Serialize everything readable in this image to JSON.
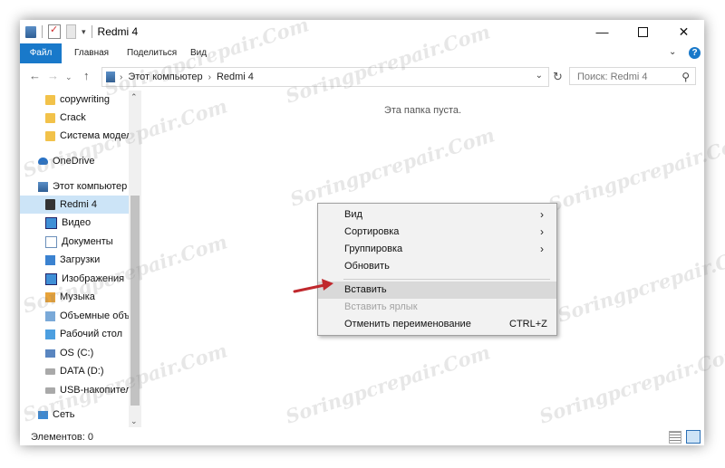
{
  "window": {
    "title": "Redmi 4",
    "controls": {
      "minimize": "—",
      "maximize": "",
      "close": "✕"
    }
  },
  "ribbon": {
    "tabs": [
      "Файл",
      "Главная",
      "Поделиться",
      "Вид"
    ],
    "help": "?"
  },
  "address": {
    "segments": [
      "Этот компьютер",
      "Redmi 4"
    ],
    "search_placeholder": "Поиск: Redmi 4"
  },
  "sidebar": {
    "items": [
      {
        "label": "copywriting",
        "icon": "folder-icon"
      },
      {
        "label": "Crack",
        "icon": "folder-icon"
      },
      {
        "label": "Система модели",
        "icon": "folder-icon"
      },
      {
        "label": "OneDrive",
        "icon": "onedrive-icon"
      },
      {
        "label": "Этот компьютер",
        "icon": "computer-icon"
      },
      {
        "label": "Redmi 4",
        "icon": "phone-icon",
        "selected": true
      },
      {
        "label": "Видео",
        "icon": "video-icon"
      },
      {
        "label": "Документы",
        "icon": "documents-icon"
      },
      {
        "label": "Загрузки",
        "icon": "downloads-icon"
      },
      {
        "label": "Изображения",
        "icon": "pictures-icon"
      },
      {
        "label": "Музыка",
        "icon": "music-icon"
      },
      {
        "label": "Объемные объекты",
        "icon": "3d-objects-icon"
      },
      {
        "label": "Рабочий стол",
        "icon": "desktop-icon"
      },
      {
        "label": "OS (C:)",
        "icon": "os-drive-icon"
      },
      {
        "label": "DATA (D:)",
        "icon": "drive-icon"
      },
      {
        "label": "USB-накопитель",
        "icon": "usb-drive-icon"
      },
      {
        "label": "Сеть",
        "icon": "network-icon"
      }
    ]
  },
  "content": {
    "empty_message": "Эта папка пуста."
  },
  "status": {
    "text": "Элементов: 0"
  },
  "context_menu": {
    "items": [
      {
        "label": "Вид",
        "submenu": true
      },
      {
        "label": "Сортировка",
        "submenu": true
      },
      {
        "label": "Группировка",
        "submenu": true
      },
      {
        "label": "Обновить"
      },
      {
        "label": "Вставить",
        "highlighted": true
      },
      {
        "label": "Вставить ярлык",
        "disabled": true
      },
      {
        "label": "Отменить переименование",
        "shortcut": "CTRL+Z"
      }
    ]
  },
  "watermark": "Soringpcrepair.Com",
  "colors": {
    "accent": "#1979ca",
    "selection": "#cce4f7",
    "menu_background": "#f2f2f2",
    "menu_hover": "#d9d9d9",
    "arrow": "#c0282d"
  }
}
